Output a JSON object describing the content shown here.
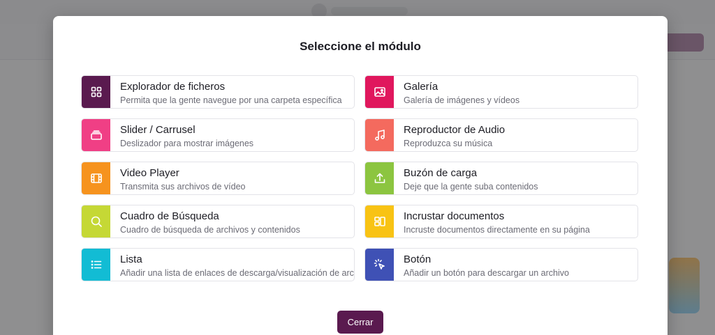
{
  "modal": {
    "title": "Seleccione el módulo",
    "close_label": "Cerrar",
    "close_color": "#5a1a4f"
  },
  "modules": [
    {
      "title": "Explorador de ficheros",
      "desc": "Permita que la gente navegue por una carpeta específica",
      "color": "#5a1a4f",
      "icon": "grid-icon"
    },
    {
      "title": "Galería",
      "desc": "Galería de imágenes y vídeos",
      "color": "#e0175d",
      "icon": "image-icon"
    },
    {
      "title": "Slider / Carrusel",
      "desc": "Deslizador para mostrar imágenes",
      "color": "#f03f85",
      "icon": "stack-icon"
    },
    {
      "title": "Reproductor de Audio",
      "desc": "Reproduzca su música",
      "color": "#f46a5e",
      "icon": "music-note-icon"
    },
    {
      "title": "Video Player",
      "desc": "Transmita sus archivos de vídeo",
      "color": "#f6931e",
      "icon": "film-icon"
    },
    {
      "title": "Buzón de carga",
      "desc": "Deje que la gente suba contenidos",
      "color": "#8cc540",
      "icon": "upload-icon"
    },
    {
      "title": "Cuadro de Búsqueda",
      "desc": "Cuadro de búsqueda de archivos y contenidos",
      "color": "#c5d835",
      "icon": "search-icon"
    },
    {
      "title": "Incrustar documentos",
      "desc": "Incruste documentos directamente en su página",
      "color": "#f8c314",
      "icon": "embed-layout-icon"
    },
    {
      "title": "Lista",
      "desc": "Añadir una lista de enlaces de descarga/visualización de archivos",
      "color": "#12bcd4",
      "icon": "list-icon"
    },
    {
      "title": "Botón",
      "desc": "Añadir un botón para descargar un archivo",
      "color": "#3f51b5",
      "icon": "click-pointer-icon"
    }
  ]
}
